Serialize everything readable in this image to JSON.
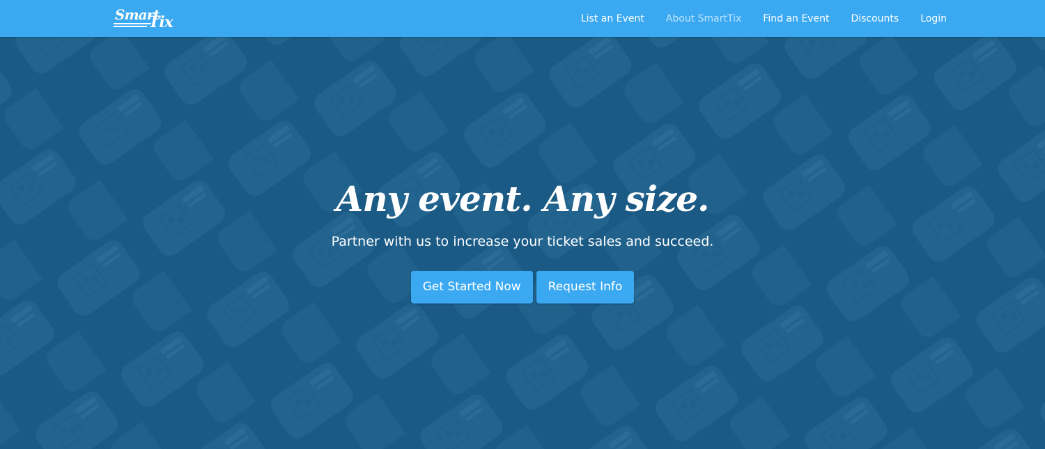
{
  "brand": {
    "logo_text_1": "Smart",
    "logo_text_2": "Tix"
  },
  "nav": {
    "items": [
      {
        "label": "List an Event"
      },
      {
        "label": "About SmartTix"
      },
      {
        "label": "Find an Event"
      },
      {
        "label": "Discounts"
      },
      {
        "label": "Login"
      }
    ]
  },
  "hero": {
    "headline": "Any event. Any size.",
    "subheadline": "Partner with us to increase your ticket sales and succeed.",
    "buttons": {
      "primary": "Get Started Now",
      "secondary": "Request Info"
    }
  },
  "colors": {
    "navbar": "#3aa9f2",
    "hero_background": "#1a5a85",
    "button": "#3aa9f2",
    "text": "#ffffff"
  },
  "icons": {
    "logo": "smarttix-logo",
    "background": "ticket-pattern-icon"
  }
}
